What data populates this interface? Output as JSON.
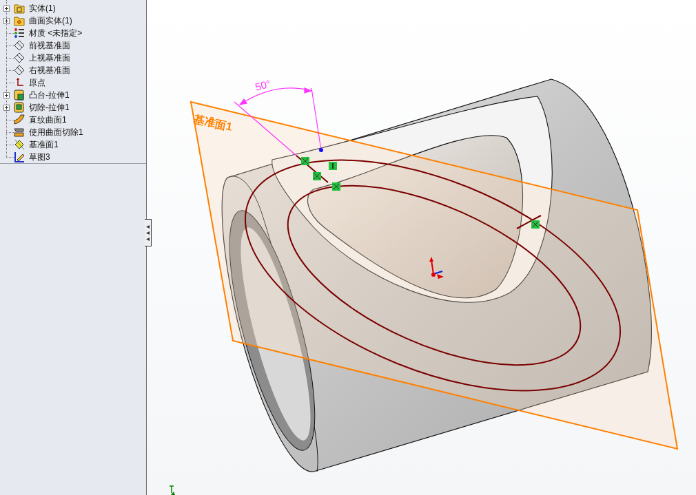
{
  "feature_tree": {
    "items": [
      {
        "kind": "solid-folder",
        "label": "实体(1)",
        "expanded": false
      },
      {
        "kind": "surface-folder",
        "label": "曲面实体(1)",
        "expanded": false
      },
      {
        "kind": "material",
        "label": "材质 <未指定>"
      },
      {
        "kind": "plane",
        "label": "前视基准面"
      },
      {
        "kind": "plane",
        "label": "上视基准面"
      },
      {
        "kind": "plane",
        "label": "右视基准面"
      },
      {
        "kind": "origin",
        "label": "原点"
      },
      {
        "kind": "boss",
        "label": "凸台-拉伸1",
        "expanded": false
      },
      {
        "kind": "cut",
        "label": "切除-拉伸1",
        "expanded": false
      },
      {
        "kind": "ruled-surface",
        "label": "直纹曲面1"
      },
      {
        "kind": "surface-cut",
        "label": "使用曲面切除1"
      },
      {
        "kind": "ref-plane",
        "label": "基准面1"
      },
      {
        "kind": "sketch",
        "label": "草图3"
      }
    ]
  },
  "viewport": {
    "plane_label": "基准面1",
    "angle_dimension": "50°"
  }
}
